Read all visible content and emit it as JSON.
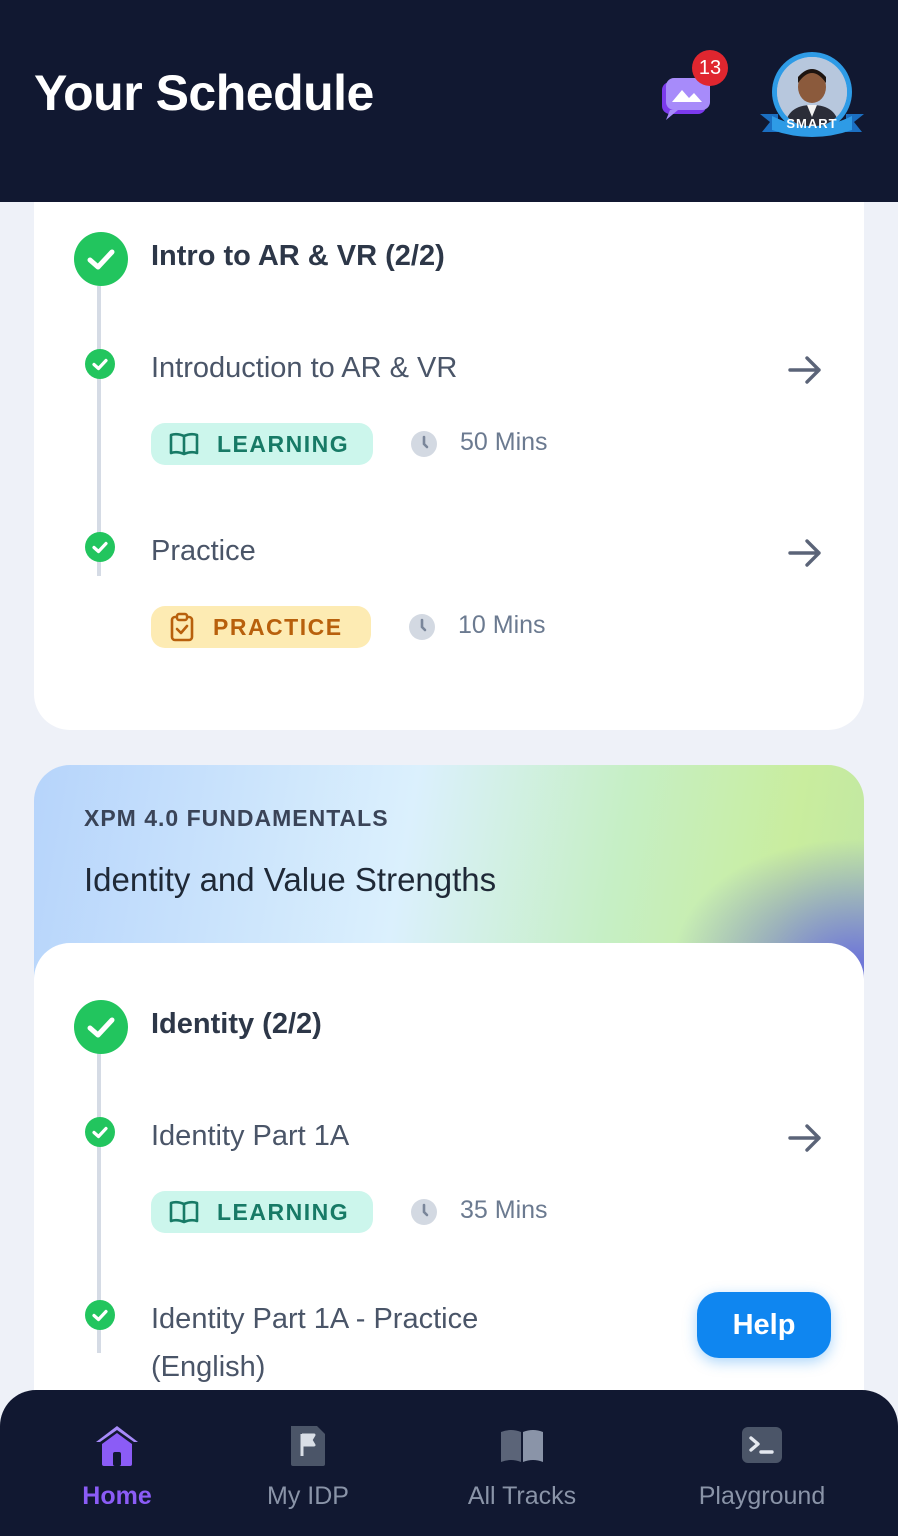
{
  "header": {
    "title": "Your Schedule",
    "chat_badge_count": "13",
    "avatar_badge": "SMART"
  },
  "module1": {
    "title": "Intro to AR & VR (2/2)",
    "items": [
      {
        "title": "Introduction to AR & VR",
        "tag": "LEARNING",
        "duration": "50 Mins"
      },
      {
        "title": "Practice",
        "tag": "PRACTICE",
        "duration": "10 Mins"
      }
    ]
  },
  "course": {
    "kicker": "XPM 4.0 FUNDAMENTALS",
    "title": "Identity and Value Strengths"
  },
  "module2": {
    "title": "Identity (2/2)",
    "items": [
      {
        "title": "Identity Part 1A",
        "tag": "LEARNING",
        "duration": "35 Mins"
      },
      {
        "title_line1": "Identity Part 1A - Practice",
        "title_line2": "(English)"
      }
    ]
  },
  "help": {
    "label": "Help"
  },
  "nav": {
    "items": [
      {
        "label": "Home",
        "icon": "home-icon",
        "active": true
      },
      {
        "label": "My IDP",
        "icon": "flag-document-icon",
        "active": false
      },
      {
        "label": "All Tracks",
        "icon": "open-book-icon",
        "active": false
      },
      {
        "label": "Playground",
        "icon": "terminal-icon",
        "active": false
      }
    ]
  },
  "colors": {
    "header_bg": "#111831",
    "success": "#22c55e",
    "learning_bg": "#ccf6ec",
    "practice_bg": "#fdebb3",
    "help_blue": "#0f86f0",
    "nav_active": "#8b5cf6"
  }
}
